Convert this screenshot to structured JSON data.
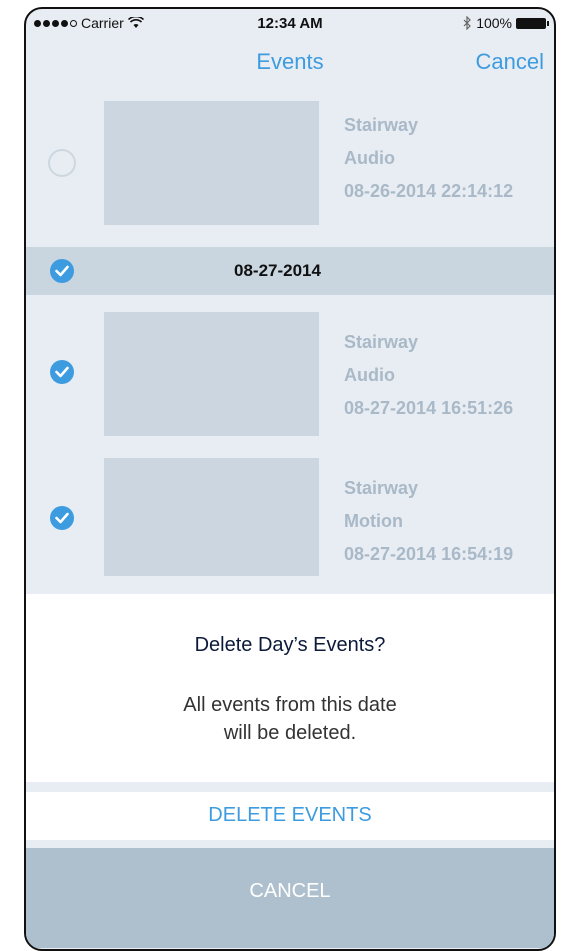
{
  "status_bar": {
    "carrier": "Carrier",
    "time": "12:34 AM",
    "battery": "100%"
  },
  "nav": {
    "title": "Events",
    "cancel": "Cancel"
  },
  "events_top": [
    {
      "location": "Stairway",
      "type": "Audio",
      "timestamp": "08-26-2014 22:14:12",
      "selected": false
    }
  ],
  "date_header": {
    "date": "08-27-2014",
    "selected": true
  },
  "events": [
    {
      "location": "Stairway",
      "type": "Audio",
      "timestamp": "08-27-2014 16:51:26",
      "selected": true
    },
    {
      "location": "Stairway",
      "type": "Motion",
      "timestamp": "08-27-2014 16:54:19",
      "selected": true
    }
  ],
  "dialog": {
    "title": "Delete Day’s Events?",
    "message_line1": "All events from this date",
    "message_line2": "will be deleted.",
    "delete_label": "DELETE EVENTS",
    "cancel_label": "CANCEL"
  },
  "colors": {
    "accent": "#3d9be0",
    "cancel_bg": "#aec0cd"
  }
}
